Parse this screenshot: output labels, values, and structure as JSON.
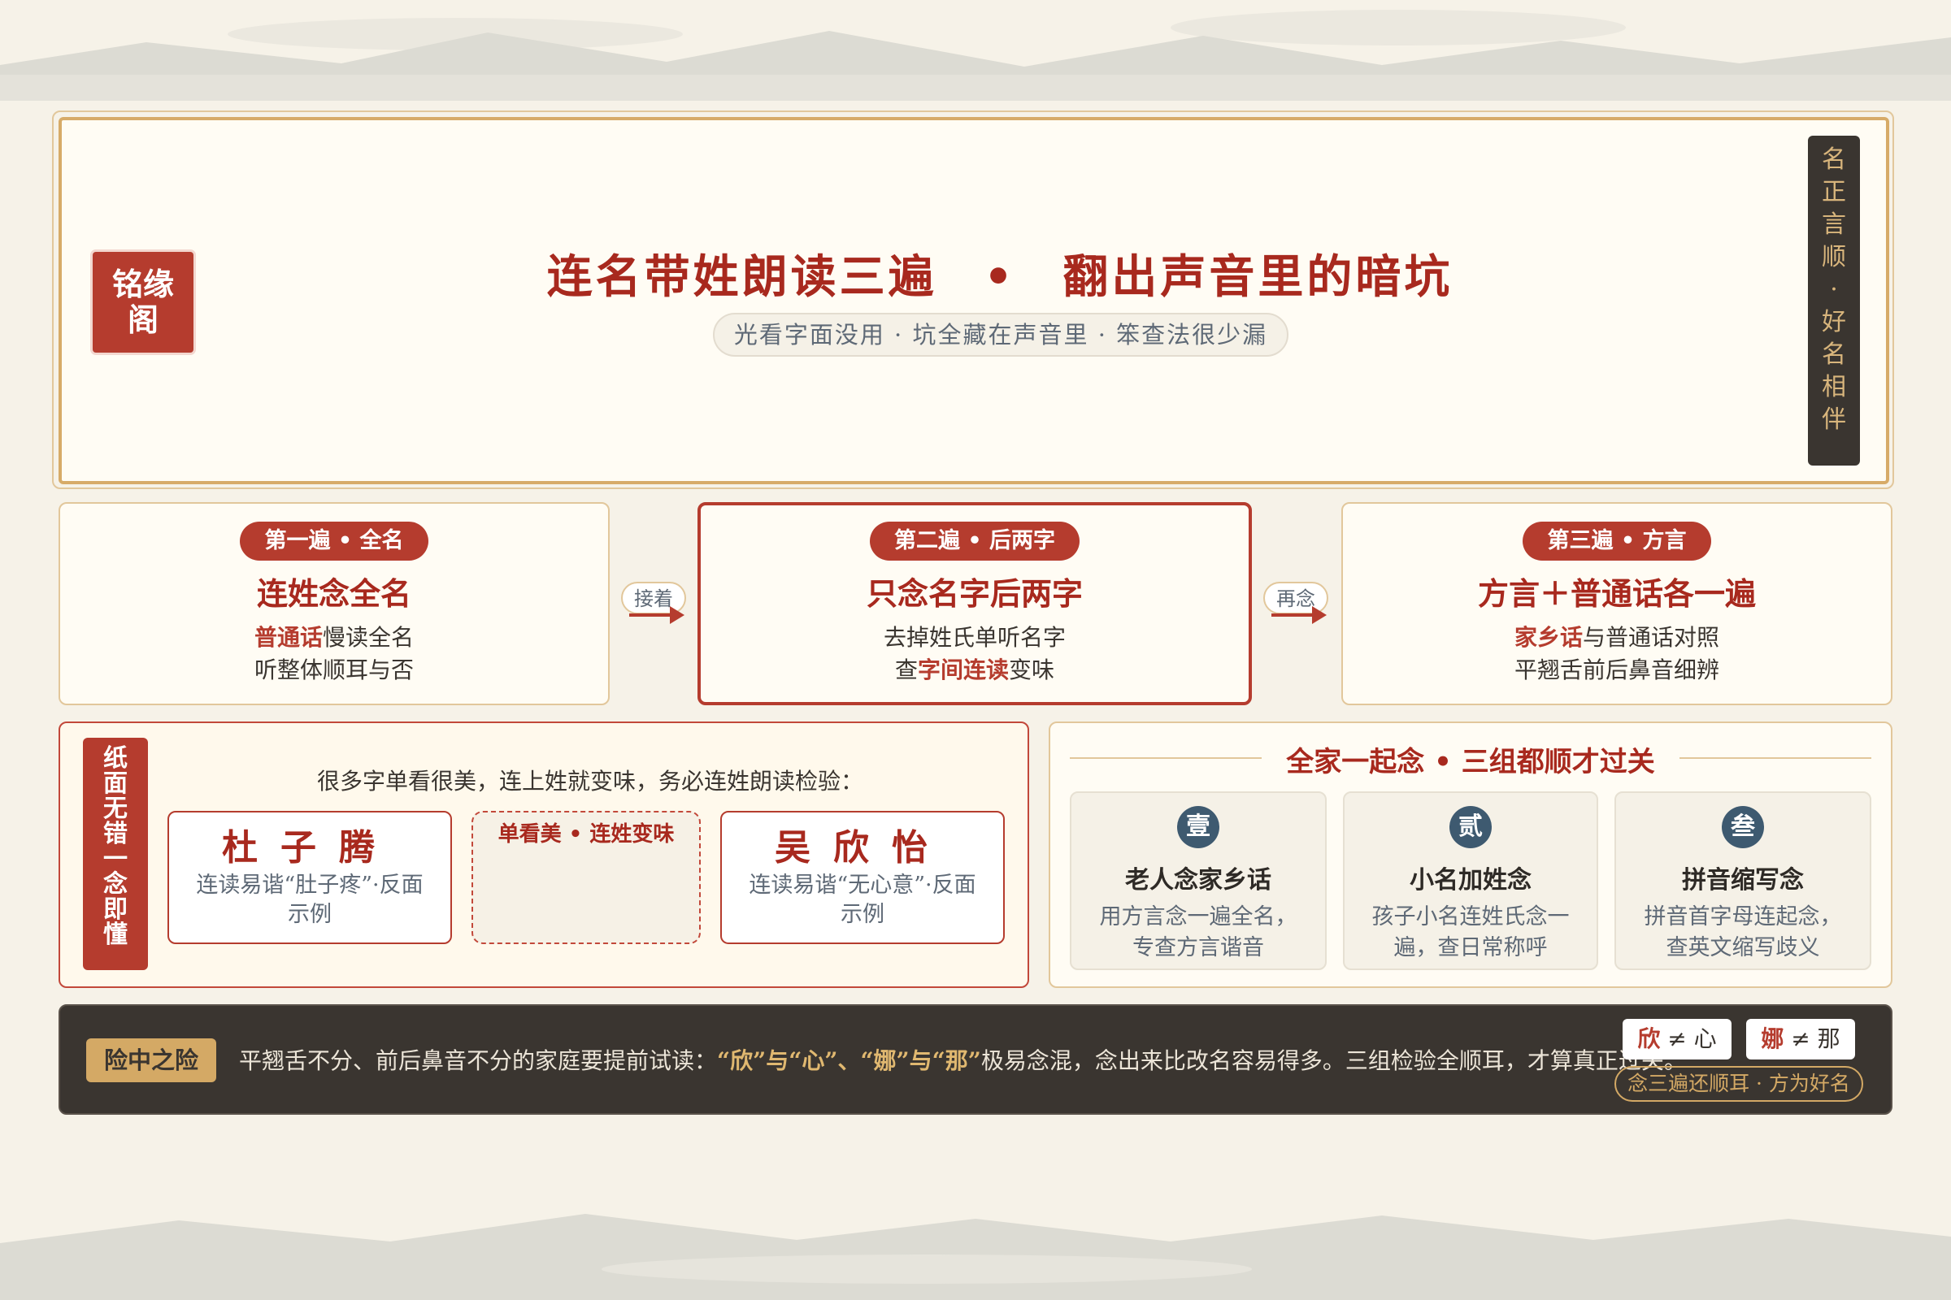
{
  "hero": {
    "seal": [
      "铭缘",
      "阁"
    ],
    "title": "连名带姓朗读三遍",
    "title_part2": "翻出声音里的暗坑",
    "separator": "•",
    "subtitle": "光看字面没用 · 坑全藏在声音里 · 笨查法很少漏",
    "side_motto": [
      "名",
      "正",
      "言",
      "顺",
      "·",
      "好",
      "名",
      "相",
      "伴"
    ]
  },
  "steps": [
    {
      "tag": "第一遍 • 全名",
      "title": "连姓念全名",
      "line1_hl": "普通话",
      "line1_rest": "慢读全名",
      "line2": "听整体顺耳与否"
    },
    {
      "tag": "第二遍 • 后两字",
      "title": "只念名字后两字",
      "line1": "去掉姓氏单听名字",
      "line2_pre": "查",
      "line2_hl": "字间连读",
      "line2_post": "变味"
    },
    {
      "tag": "第三遍 • 方言",
      "title": "方言＋普通话各一遍",
      "line1_hl": "家乡话",
      "line1_rest": "与普通话对照",
      "line2": "平翘舌前后鼻音细辨"
    }
  ],
  "connectors": [
    "接着",
    "再念"
  ],
  "paper": {
    "tab": [
      "纸",
      "面",
      "无",
      "错",
      "一",
      "念",
      "即",
      "懂"
    ],
    "intro": "很多字单看很美，连上姓就变味，务必连姓朗读检验：",
    "left_name": "杜子腾",
    "left_desc": "连读易谐“肚子疼”·反面示例",
    "middle_label": "单看美 • 连姓变味",
    "right_name": "吴欣怡",
    "right_desc": "连读易谐“无心意”·反面示例"
  },
  "family": {
    "title": "全家一起念 • 三组都顺才过关",
    "items": [
      {
        "num": "壹",
        "title": "老人念家乡话",
        "desc": "用方言念一遍全名，专查方言谐音"
      },
      {
        "num": "贰",
        "title": "小名加姓念",
        "desc": "孩子小名连姓氏念一遍，查日常称呼"
      },
      {
        "num": "叁",
        "title": "拼音缩写念",
        "desc": "拼音首字母连起念，查英文缩写歧义"
      }
    ]
  },
  "footer": {
    "badge": "险中之险",
    "text_pre": "平翘舌不分、前后鼻音不分的家庭要提前试读：",
    "text_hl": "“欣”与“心”、“娜”与“那”",
    "text_post": "极易念混，念出来比改名容易得多。三组检验全顺耳，才算真正过关。",
    "cmp1_a": "欣",
    "cmp1_op": "≠",
    "cmp1_b": "心",
    "cmp2_a": "娜",
    "cmp2_op": "≠",
    "cmp2_b": "那",
    "motto": "念三遍还顺耳 · 方为好名"
  },
  "colors": {
    "accent": "#b53c2e",
    "gold": "#d4a965",
    "dark": "#3a3530",
    "paper": "#fffcf4"
  }
}
